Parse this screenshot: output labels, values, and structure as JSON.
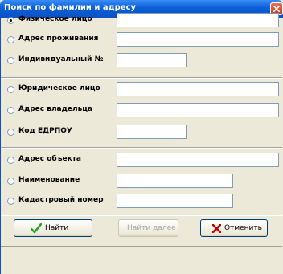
{
  "window": {
    "title": "Поиск по фамилии и адресу"
  },
  "options": [
    {
      "label": "Физическое лицо",
      "value": "",
      "checked": true
    },
    {
      "label": "Адрес проживания",
      "value": ""
    },
    {
      "label": "Индивидуальный №",
      "value": ""
    },
    {
      "label": "Юридическое лицо",
      "value": ""
    },
    {
      "label": "Адрес владельца",
      "value": ""
    },
    {
      "label": "Код ЕДРПОУ",
      "value": ""
    },
    {
      "label": "Адрес объекта",
      "value": ""
    },
    {
      "label": "Наименование",
      "value": ""
    },
    {
      "label": "Кадастровый номер",
      "value": ""
    }
  ],
  "buttons": {
    "find": "Найти",
    "find_next": "Найти далее",
    "cancel": "Отменить"
  },
  "colors": {
    "titlebar": "#0a5fd8",
    "check_icon": "#2ca02c",
    "cancel_icon": "#c00000"
  },
  "icons": {
    "find": "checkmark-icon",
    "cancel": "cross-icon",
    "close": "close-icon"
  }
}
